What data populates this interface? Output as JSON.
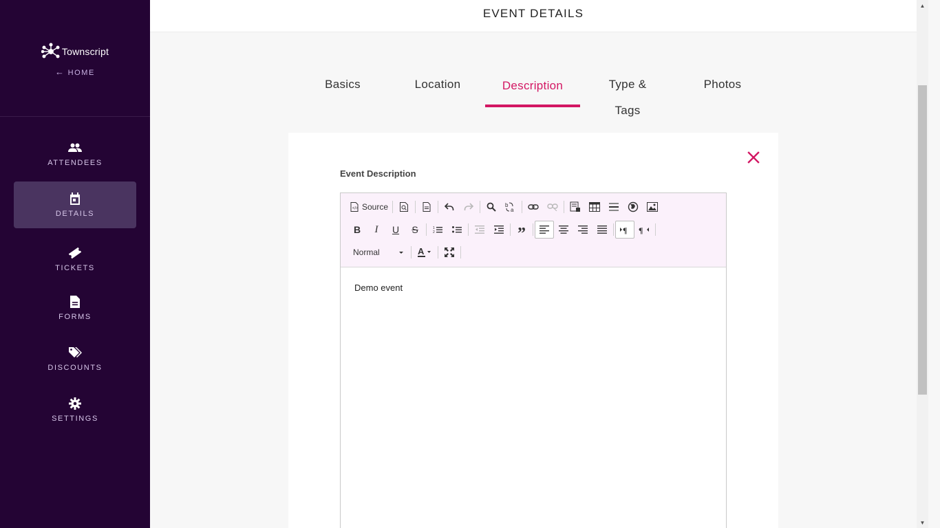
{
  "sidebar": {
    "brand": "Townscript",
    "home_label": "HOME",
    "items": [
      {
        "label": "ATTENDEES",
        "icon": "people-icon"
      },
      {
        "label": "DETAILS",
        "icon": "calendar-icon",
        "active": true
      },
      {
        "label": "TICKETS",
        "icon": "ticket-icon"
      },
      {
        "label": "FORMS",
        "icon": "document-icon"
      },
      {
        "label": "DISCOUNTS",
        "icon": "tag-icon"
      },
      {
        "label": "SETTINGS",
        "icon": "gear-icon"
      }
    ]
  },
  "header": {
    "title": "EVENT DETAILS"
  },
  "tabs": [
    {
      "label": "Basics"
    },
    {
      "label": "Location"
    },
    {
      "label": "Description",
      "active": true
    },
    {
      "label": "Type &\nTags"
    },
    {
      "label": "Photos"
    }
  ],
  "form": {
    "label": "Event Description",
    "content": "Demo event"
  },
  "editor": {
    "source_label": "Source",
    "format_label": "Normal"
  },
  "colors": {
    "sidebar_bg": "#240434",
    "accent": "#d31763",
    "active_nav_bg": "#4a3460"
  }
}
